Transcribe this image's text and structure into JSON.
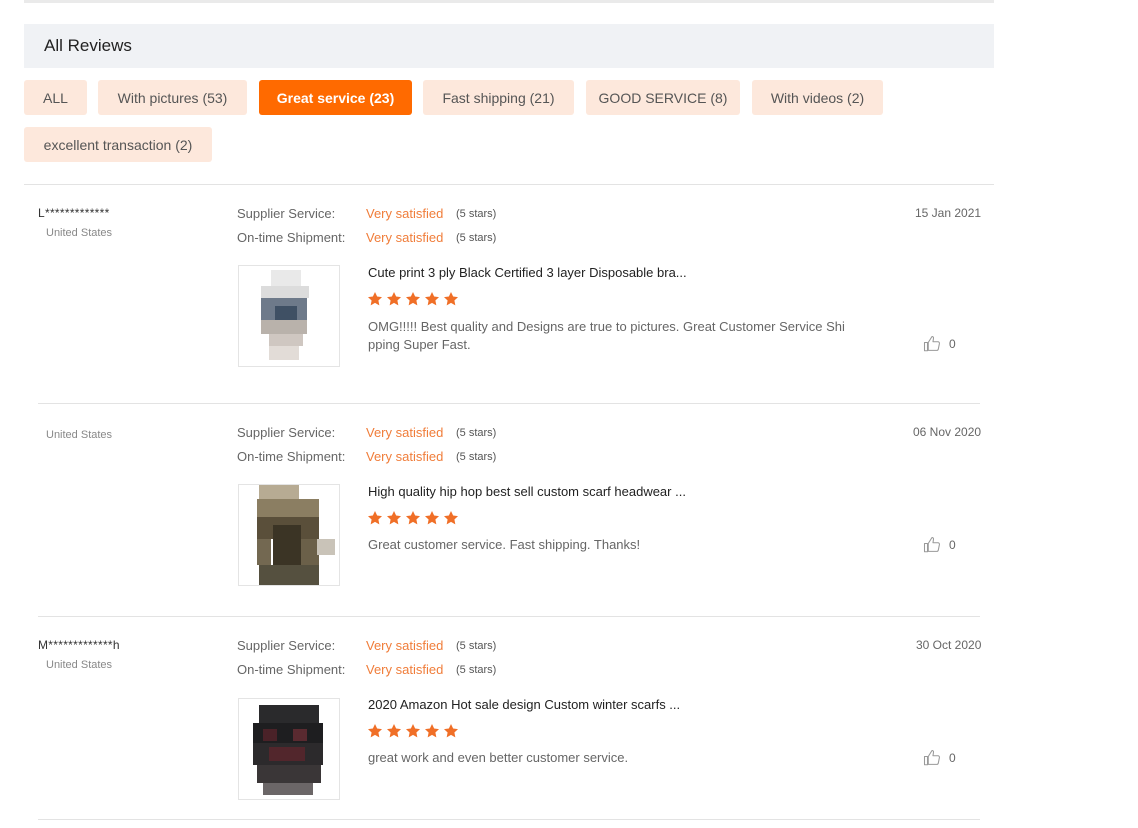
{
  "header": {
    "title": "All Reviews"
  },
  "filters": [
    {
      "label": "ALL",
      "active": false
    },
    {
      "label": "With pictures (53)",
      "active": false
    },
    {
      "label": "Great service (23)",
      "active": true
    },
    {
      "label": "Fast shipping (21)",
      "active": false
    },
    {
      "label": "GOOD SERVICE (8)",
      "active": false
    },
    {
      "label": "With videos (2)",
      "active": false
    },
    {
      "label": "excellent transaction (2)",
      "active": false
    }
  ],
  "labels": {
    "supplier_service": "Supplier Service:",
    "ontime_shipment": "On-time Shipment:"
  },
  "colors": {
    "accent": "#ff6a00",
    "chip_bg": "#fde8dc",
    "rating_text": "#f07d3a",
    "star": "#f06f27"
  },
  "reviews": [
    {
      "username": "L*************",
      "country": "United States",
      "date": "15 Jan 2021",
      "supplier_service": {
        "value": "Very satisfied",
        "stars": "(5 stars)"
      },
      "ontime_shipment": {
        "value": "Very satisfied",
        "stars": "(5 stars)"
      },
      "product_title": "Cute print 3 ply Black Certified 3 layer Disposable bra...",
      "rating": 5,
      "comment": "OMG!!!!! Best quality and Designs are true to pictures. Great Customer Service Shi pping Super Fast.",
      "likes": "0",
      "icon": "like-icon"
    },
    {
      "username": "",
      "country": "United States",
      "date": "06 Nov 2020",
      "supplier_service": {
        "value": "Very satisfied",
        "stars": "(5 stars)"
      },
      "ontime_shipment": {
        "value": "Very satisfied",
        "stars": "(5 stars)"
      },
      "product_title": "High quality hip hop best sell custom scarf headwear ...",
      "rating": 5,
      "comment": "Great customer service. Fast shipping.  Thanks!",
      "likes": "0",
      "icon": "like-icon"
    },
    {
      "username": "M*************h",
      "country": "United States",
      "date": "30 Oct 2020",
      "supplier_service": {
        "value": "Very satisfied",
        "stars": "(5 stars)"
      },
      "ontime_shipment": {
        "value": "Very satisfied",
        "stars": "(5 stars)"
      },
      "product_title": "2020 Amazon Hot sale design Custom winter scarfs ...",
      "rating": 5,
      "comment": "great work and even better customer service.",
      "likes": "0",
      "icon": "like-icon"
    }
  ]
}
